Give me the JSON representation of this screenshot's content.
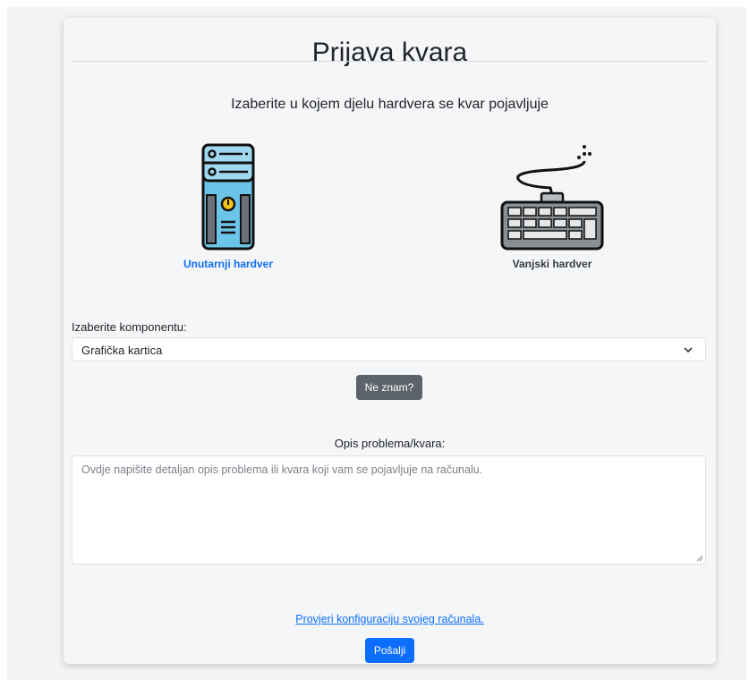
{
  "header": {
    "title": "Prijava kvara"
  },
  "hardware_prompt": "Izaberite u kojem djelu hardvera se kvar pojavljuje",
  "hardware_options": [
    {
      "label": "Unutarnji hardver",
      "icon": "pc-tower-icon",
      "selected": true
    },
    {
      "label": "Vanjski hardver",
      "icon": "keyboard-icon",
      "selected": false
    }
  ],
  "component": {
    "label": "Izaberite komponentu:",
    "selected": "Grafička kartica"
  },
  "dunno_button": "Ne znam?",
  "description": {
    "label": "Opis problema/kvara:",
    "placeholder": "Ovdje napišite detaljan opis problema ili kvara koji vam se pojavljuje na računalu.",
    "value": ""
  },
  "config_link": "Provjeri konfiguraciju svojeg računala.",
  "submit_button": "Pošalji",
  "colors": {
    "accent": "#0d6efd",
    "secondary_button": "#5c636a",
    "tower_body": "#6cc5e8"
  }
}
